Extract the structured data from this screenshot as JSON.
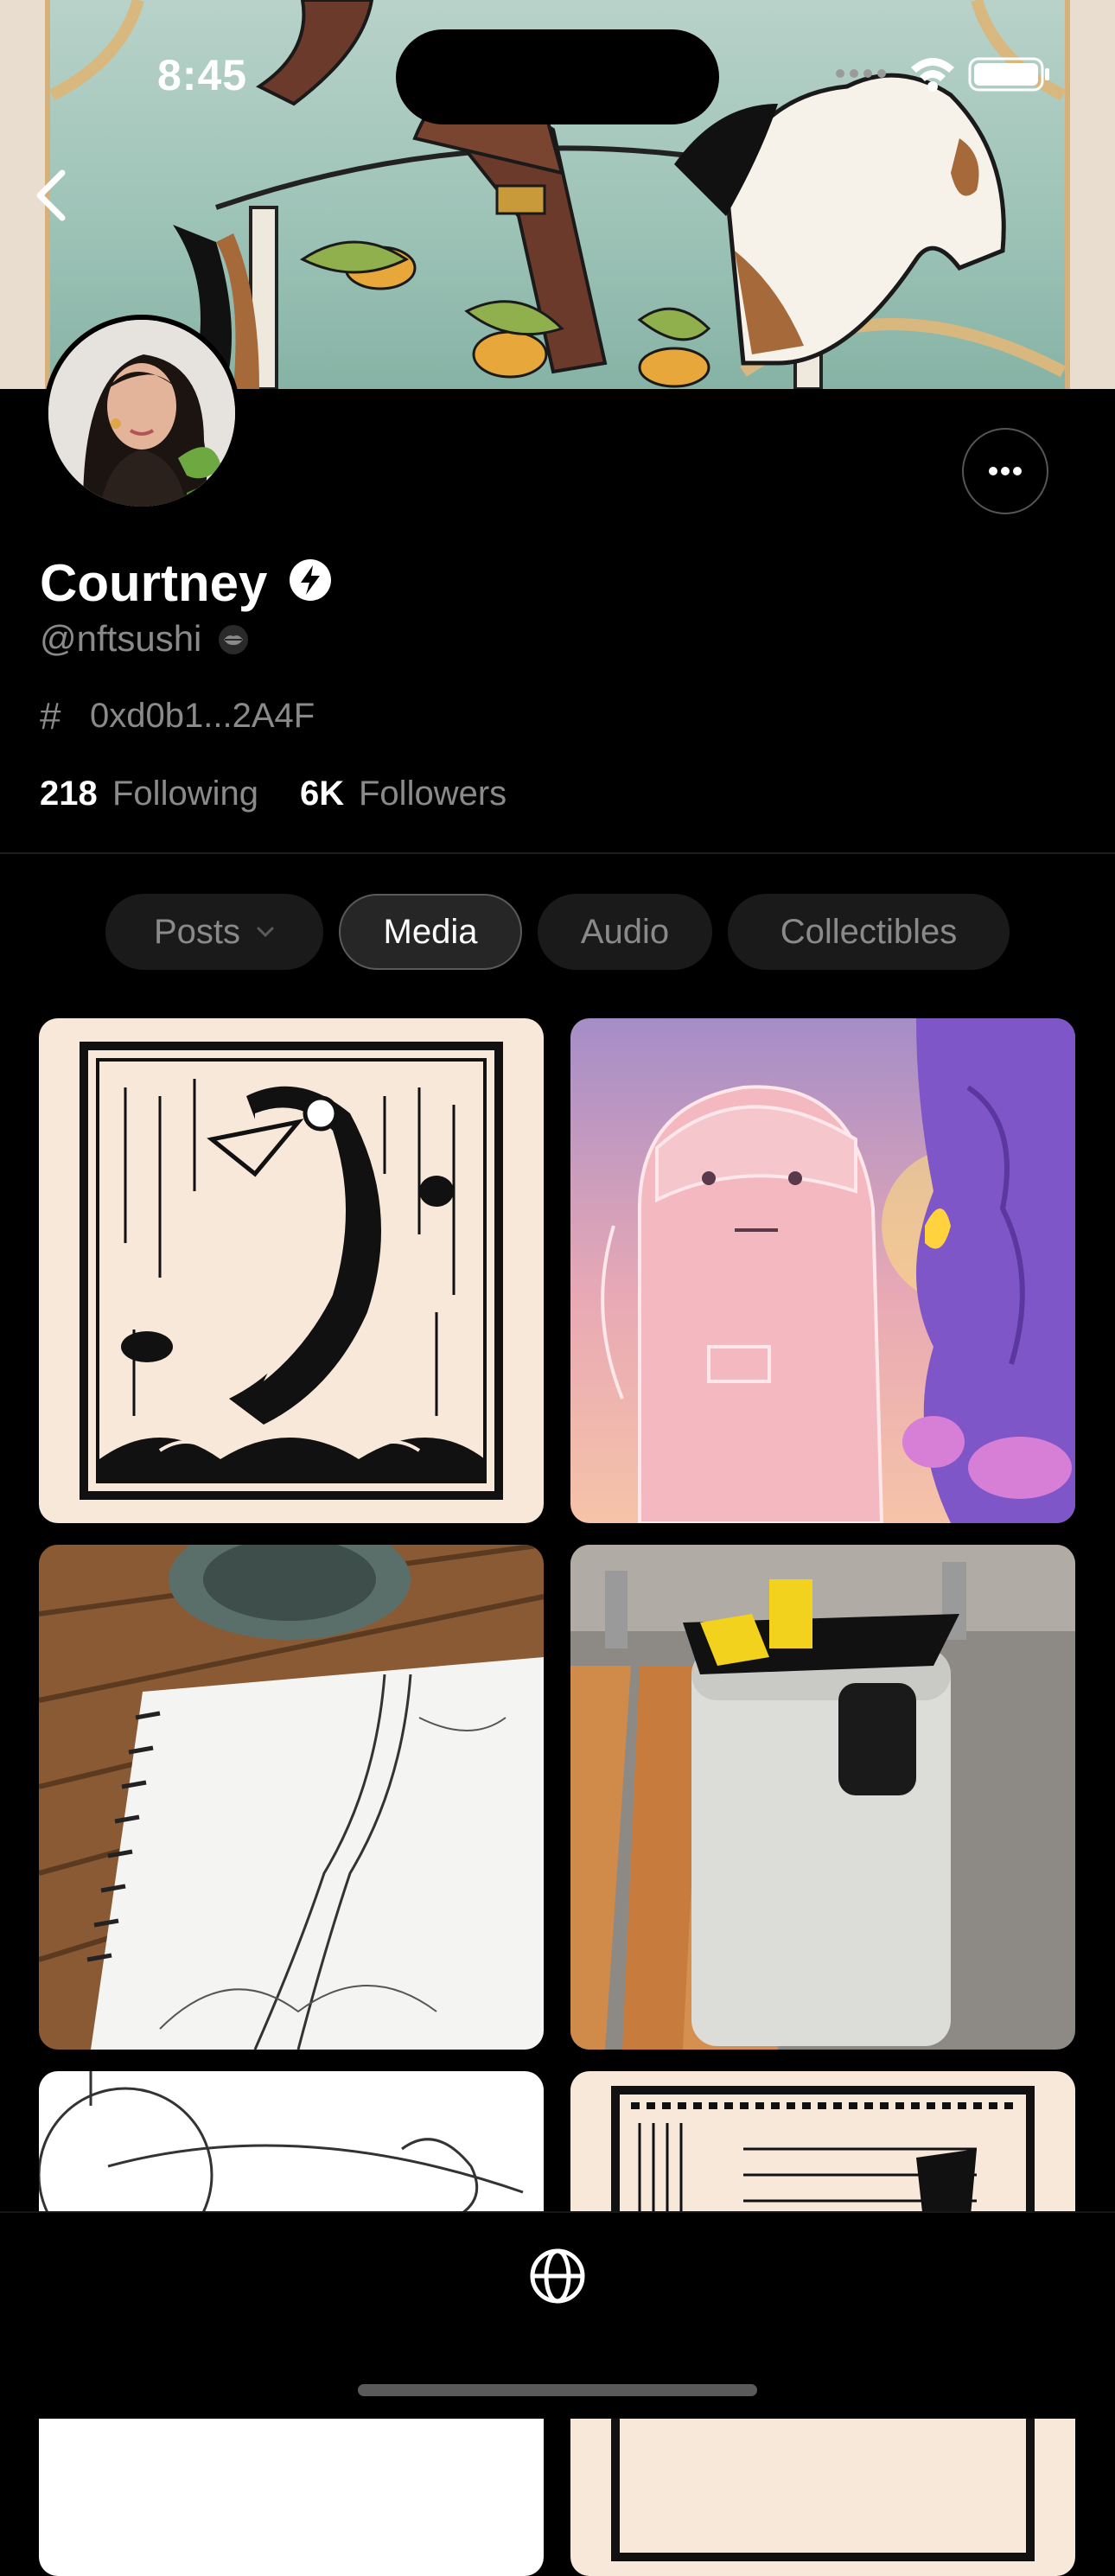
{
  "status_bar": {
    "time": "8:45"
  },
  "profile": {
    "name": "Courtney",
    "handle": "@nftsushi",
    "wallet_address": "0xd0b1...2A4F",
    "following_count": "218",
    "following_label": "Following",
    "followers_count": "6K",
    "followers_label": "Followers"
  },
  "tabs": [
    {
      "label": "Posts",
      "active": false,
      "has_dropdown": true
    },
    {
      "label": "Media",
      "active": true
    },
    {
      "label": "Audio",
      "active": false
    },
    {
      "label": "Collectibles",
      "active": false
    }
  ],
  "icons": {
    "back": "chevron-left-icon",
    "more": "ellipsis-icon",
    "verified": "lightning-bolt-icon",
    "wallet": "hash-icon",
    "bottom_nav": "globe-icon"
  },
  "colors": {
    "background": "#000000",
    "text_primary": "#ffffff",
    "text_secondary": "#8a8a8a",
    "tab_bg": "#1a1a1a",
    "tab_active_border": "#5a5a5a"
  }
}
